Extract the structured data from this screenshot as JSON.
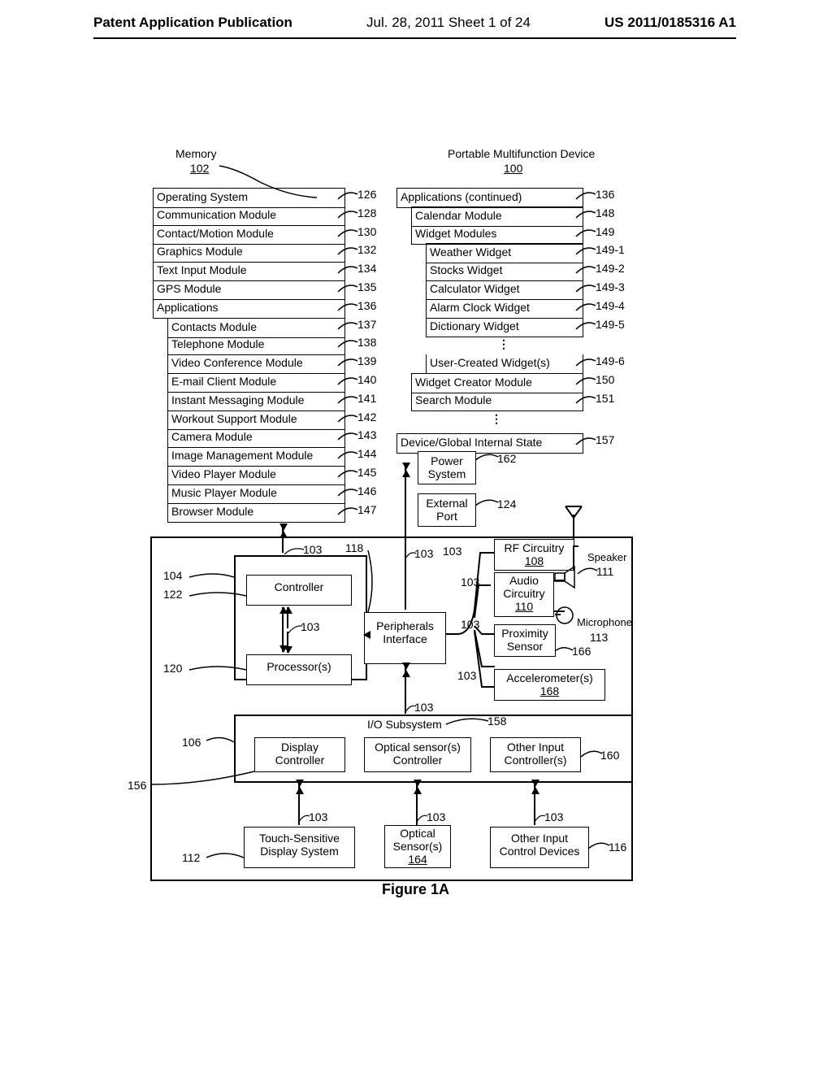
{
  "header": {
    "left": "Patent Application Publication",
    "center": "Jul. 28, 2011  Sheet 1 of 24",
    "right": "US 2011/0185316 A1"
  },
  "figure_caption": "Figure 1A",
  "memory": {
    "title": "Memory",
    "ref": "102"
  },
  "device": {
    "title": "Portable Multifunction Device",
    "ref": "100"
  },
  "left_stack": {
    "items": [
      {
        "label": "Operating System",
        "ref": "126"
      },
      {
        "label": "Communication Module",
        "ref": "128"
      },
      {
        "label": "Contact/Motion Module",
        "ref": "130"
      },
      {
        "label": "Graphics Module",
        "ref": "132"
      },
      {
        "label": "Text Input Module",
        "ref": "134"
      },
      {
        "label": "GPS Module",
        "ref": "135"
      },
      {
        "label": "Applications",
        "ref": "136"
      },
      {
        "label": "Contacts Module",
        "ref": "137",
        "indent": 1
      },
      {
        "label": "Telephone Module",
        "ref": "138",
        "indent": 1
      },
      {
        "label": "Video Conference Module",
        "ref": "139",
        "indent": 1
      },
      {
        "label": "E-mail Client Module",
        "ref": "140",
        "indent": 1
      },
      {
        "label": "Instant Messaging Module",
        "ref": "141",
        "indent": 1
      },
      {
        "label": "Workout Support Module",
        "ref": "142",
        "indent": 1
      },
      {
        "label": "Camera Module",
        "ref": "143",
        "indent": 1
      },
      {
        "label": "Image Management Module",
        "ref": "144",
        "indent": 1
      },
      {
        "label": "Video Player Module",
        "ref": "145",
        "indent": 1
      },
      {
        "label": "Music Player Module",
        "ref": "146",
        "indent": 1
      },
      {
        "label": "Browser Module",
        "ref": "147",
        "indent": 1
      }
    ]
  },
  "right_stack": {
    "items": [
      {
        "label": "Applications (continued)",
        "ref": "136"
      },
      {
        "label": "Calendar Module",
        "ref": "148",
        "indent": 1
      },
      {
        "label": "Widget Modules",
        "ref": "149",
        "indent": 1
      },
      {
        "label": "Weather Widget",
        "ref": "149-1",
        "indent": 2
      },
      {
        "label": "Stocks Widget",
        "ref": "149-2",
        "indent": 2
      },
      {
        "label": "Calculator Widget",
        "ref": "149-3",
        "indent": 2
      },
      {
        "label": "Alarm Clock Widget",
        "ref": "149-4",
        "indent": 2
      },
      {
        "label": "Dictionary Widget",
        "ref": "149-5",
        "indent": 2
      },
      {
        "label": "⋮",
        "ref": "",
        "indent": 2,
        "dots": true
      },
      {
        "label": "User-Created Widget(s)",
        "ref": "149-6",
        "indent": 2
      },
      {
        "label": "Widget Creator Module",
        "ref": "150",
        "indent": 1
      },
      {
        "label": "Search Module",
        "ref": "151",
        "indent": 1
      },
      {
        "label": "⋮",
        "ref": "",
        "indent": 1,
        "dots": true
      },
      {
        "label": "Device/Global Internal State",
        "ref": "157"
      }
    ]
  },
  "blocks": {
    "power_system": {
      "label": "Power\nSystem",
      "ref": "162"
    },
    "external_port": {
      "label": "External\nPort",
      "ref": "124"
    },
    "controller": {
      "label": "Controller",
      "ref_main": ""
    },
    "processors": {
      "label": "Processor(s)"
    },
    "peripherals": {
      "label": "Peripherals\nInterface"
    },
    "rf": {
      "label": "RF Circuitry",
      "ref": "108"
    },
    "audio": {
      "label": "Audio\nCircuitry",
      "ref": "110"
    },
    "proximity": {
      "label": "Proximity\nSensor",
      "ref": "166"
    },
    "accel": {
      "label": "Accelerometer(s)",
      "ref": "168"
    },
    "speaker": {
      "label": "Speaker",
      "ref": "111"
    },
    "microphone": {
      "label": "Microphone",
      "ref": "113"
    },
    "io_subsystem": {
      "label": "I/O Subsystem",
      "ref": "158"
    },
    "display_controller": {
      "label": "Display\nController",
      "ref": "156"
    },
    "optical_controller": {
      "label": "Optical sensor(s)\nController"
    },
    "other_controllers": {
      "label": "Other Input\nController(s)",
      "ref": "160"
    },
    "touch_display": {
      "label": "Touch-Sensitive\nDisplay System",
      "ref": "112"
    },
    "optical_sensors": {
      "label": "Optical\nSensor(s)",
      "ref": "164"
    },
    "other_devices": {
      "label": "Other Input\nControl Devices",
      "ref": "116"
    }
  },
  "shared_refs": {
    "num103": "103",
    "num118": "118",
    "num104": "104",
    "num122": "122",
    "num120": "120",
    "num106": "106"
  }
}
